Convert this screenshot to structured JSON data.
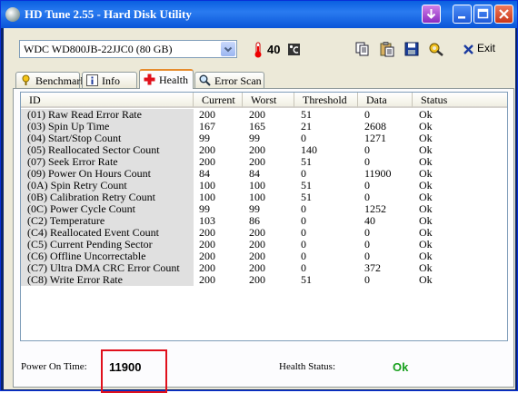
{
  "window": {
    "title": "HD Tune 2.55 - Hard Disk Utility"
  },
  "toolbar": {
    "drive": "WDC WD800JB-22JJC0 (80 GB)",
    "temperature": "40",
    "temperature_unit_icon": "celsius-unit-icon",
    "exit_label": "Exit"
  },
  "tabs": [
    {
      "label": "Benchmark",
      "icon": "benchmark-icon"
    },
    {
      "label": "Info",
      "icon": "info-icon"
    },
    {
      "label": "Health",
      "icon": "health-cross-icon",
      "active": true
    },
    {
      "label": "Error Scan",
      "icon": "magnifier-icon"
    }
  ],
  "health": {
    "columns": [
      "ID",
      "Current",
      "Worst",
      "Threshold",
      "Data",
      "Status"
    ],
    "rows": [
      [
        "(01) Raw Read Error Rate",
        "200",
        "200",
        "51",
        "0",
        "Ok"
      ],
      [
        "(03) Spin Up Time",
        "167",
        "165",
        "21",
        "2608",
        "Ok"
      ],
      [
        "(04) Start/Stop Count",
        "99",
        "99",
        "0",
        "1271",
        "Ok"
      ],
      [
        "(05) Reallocated Sector Count",
        "200",
        "200",
        "140",
        "0",
        "Ok"
      ],
      [
        "(07) Seek Error Rate",
        "200",
        "200",
        "51",
        "0",
        "Ok"
      ],
      [
        "(09) Power On Hours Count",
        "84",
        "84",
        "0",
        "11900",
        "Ok"
      ],
      [
        "(0A) Spin Retry Count",
        "100",
        "100",
        "51",
        "0",
        "Ok"
      ],
      [
        "(0B) Calibration Retry Count",
        "100",
        "100",
        "51",
        "0",
        "Ok"
      ],
      [
        "(0C) Power Cycle Count",
        "99",
        "99",
        "0",
        "1252",
        "Ok"
      ],
      [
        "(C2) Temperature",
        "103",
        "86",
        "0",
        "40",
        "Ok"
      ],
      [
        "(C4) Reallocated Event Count",
        "200",
        "200",
        "0",
        "0",
        "Ok"
      ],
      [
        "(C5) Current Pending Sector",
        "200",
        "200",
        "0",
        "0",
        "Ok"
      ],
      [
        "(C6) Offline Uncorrectable",
        "200",
        "200",
        "0",
        "0",
        "Ok"
      ],
      [
        "(C7) Ultra DMA CRC Error Count",
        "200",
        "200",
        "0",
        "372",
        "Ok"
      ],
      [
        "(C8) Write Error Rate",
        "200",
        "200",
        "51",
        "0",
        "Ok"
      ]
    ],
    "power_on_time_label": "Power On Time:",
    "power_on_time_value": "11900",
    "health_status_label": "Health Status:",
    "health_status_value": "Ok"
  },
  "colors": {
    "titlebar": "#0a5fe0",
    "highlight_box": "#e0101c",
    "health_ok": "#19a01e",
    "id_column_bg": "#e0e0e0"
  }
}
